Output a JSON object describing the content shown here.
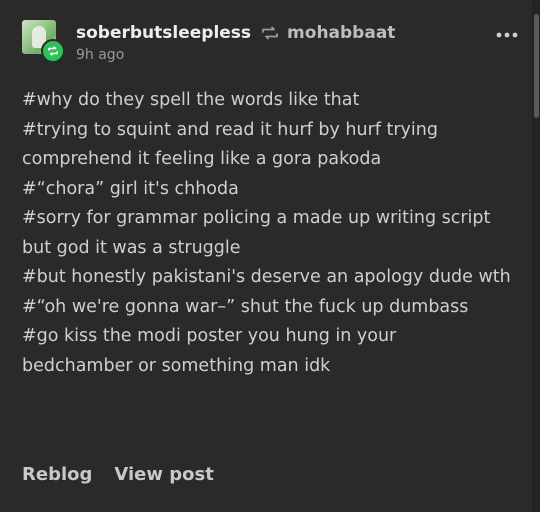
{
  "post": {
    "username": "soberbutsleepless",
    "reblogged_from": "mohabbaat",
    "time": "9h ago",
    "tags": [
      "#why do they spell the words like that",
      "#trying to squint and read it hurf by hurf trying comprehend it feeling like a gora pakoda",
      "#“chora” girl it's chhoda",
      "#sorry for grammar policing a made up writing script but god it was a struggle",
      "#but honestly pakistani's deserve an apology dude wth",
      "#“oh we're gonna war–” shut the fuck up dumbass",
      "#go kiss the modi poster you hung in your bedchamber or something man idk"
    ],
    "actions": {
      "reblog": "Reblog",
      "view_post": "View post"
    }
  },
  "icons": {
    "avatar": "user-avatar",
    "badge": "reblog-badge-icon",
    "reblog": "reblog-arrows-icon",
    "more": "more-options-icon"
  },
  "colors": {
    "background": "#2a2a2a",
    "badge": "#2fbf5b"
  }
}
